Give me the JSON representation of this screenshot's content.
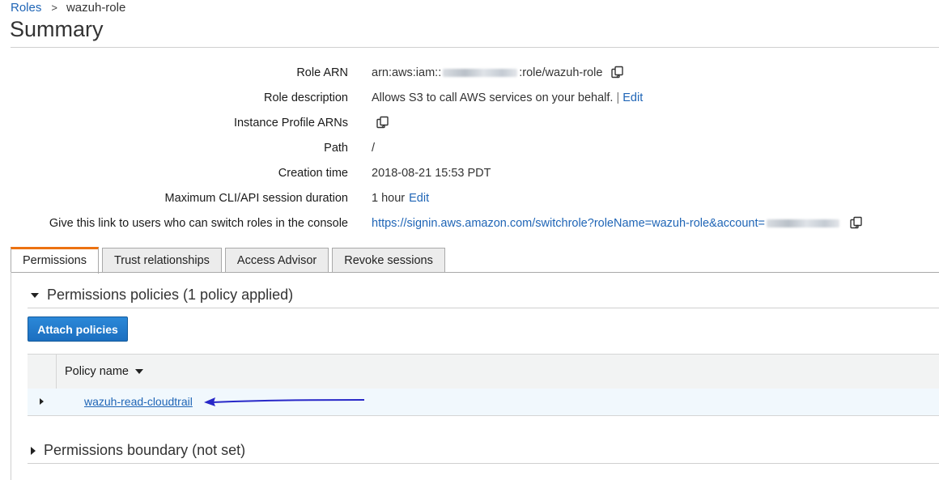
{
  "breadcrumb": {
    "parent": "Roles",
    "separator": ">",
    "current": "wazuh-role"
  },
  "page_title": "Summary",
  "summary": {
    "role_arn": {
      "label": "Role ARN",
      "prefix": "arn:aws:iam::",
      "suffix": ":role/wazuh-role"
    },
    "role_description": {
      "label": "Role description",
      "value": "Allows S3 to call AWS services on your behalf.",
      "separator": "|",
      "edit": "Edit"
    },
    "instance_profile_arns": {
      "label": "Instance Profile ARNs"
    },
    "path": {
      "label": "Path",
      "value": "/"
    },
    "creation_time": {
      "label": "Creation time",
      "value": "2018-08-21 15:53 PDT"
    },
    "max_session": {
      "label": "Maximum CLI/API session duration",
      "value": "1 hour",
      "edit": "Edit"
    },
    "switch_role_link": {
      "label": "Give this link to users who can switch roles in the console",
      "value": "https://signin.aws.amazon.com/switchrole?roleName=wazuh-role&account="
    }
  },
  "tabs": [
    {
      "label": "Permissions",
      "active": true
    },
    {
      "label": "Trust relationships",
      "active": false
    },
    {
      "label": "Access Advisor",
      "active": false
    },
    {
      "label": "Revoke sessions",
      "active": false
    }
  ],
  "permissions_policies": {
    "header": "Permissions policies (1 policy applied)",
    "attach_button": "Attach policies",
    "column_header": "Policy name",
    "rows": [
      {
        "name": "wazuh-read-cloudtrail"
      }
    ]
  },
  "permissions_boundary": {
    "header": "Permissions boundary (not set)"
  },
  "colors": {
    "link": "#1f65b6",
    "active_tab_accent": "#ec7211",
    "primary_button": "#1c6fc0",
    "annotation_arrow": "#2828c8"
  },
  "icons": [
    "copy-icon",
    "caret-down-icon",
    "caret-right-icon",
    "sort-caret-icon",
    "annotation-arrow-icon"
  ]
}
